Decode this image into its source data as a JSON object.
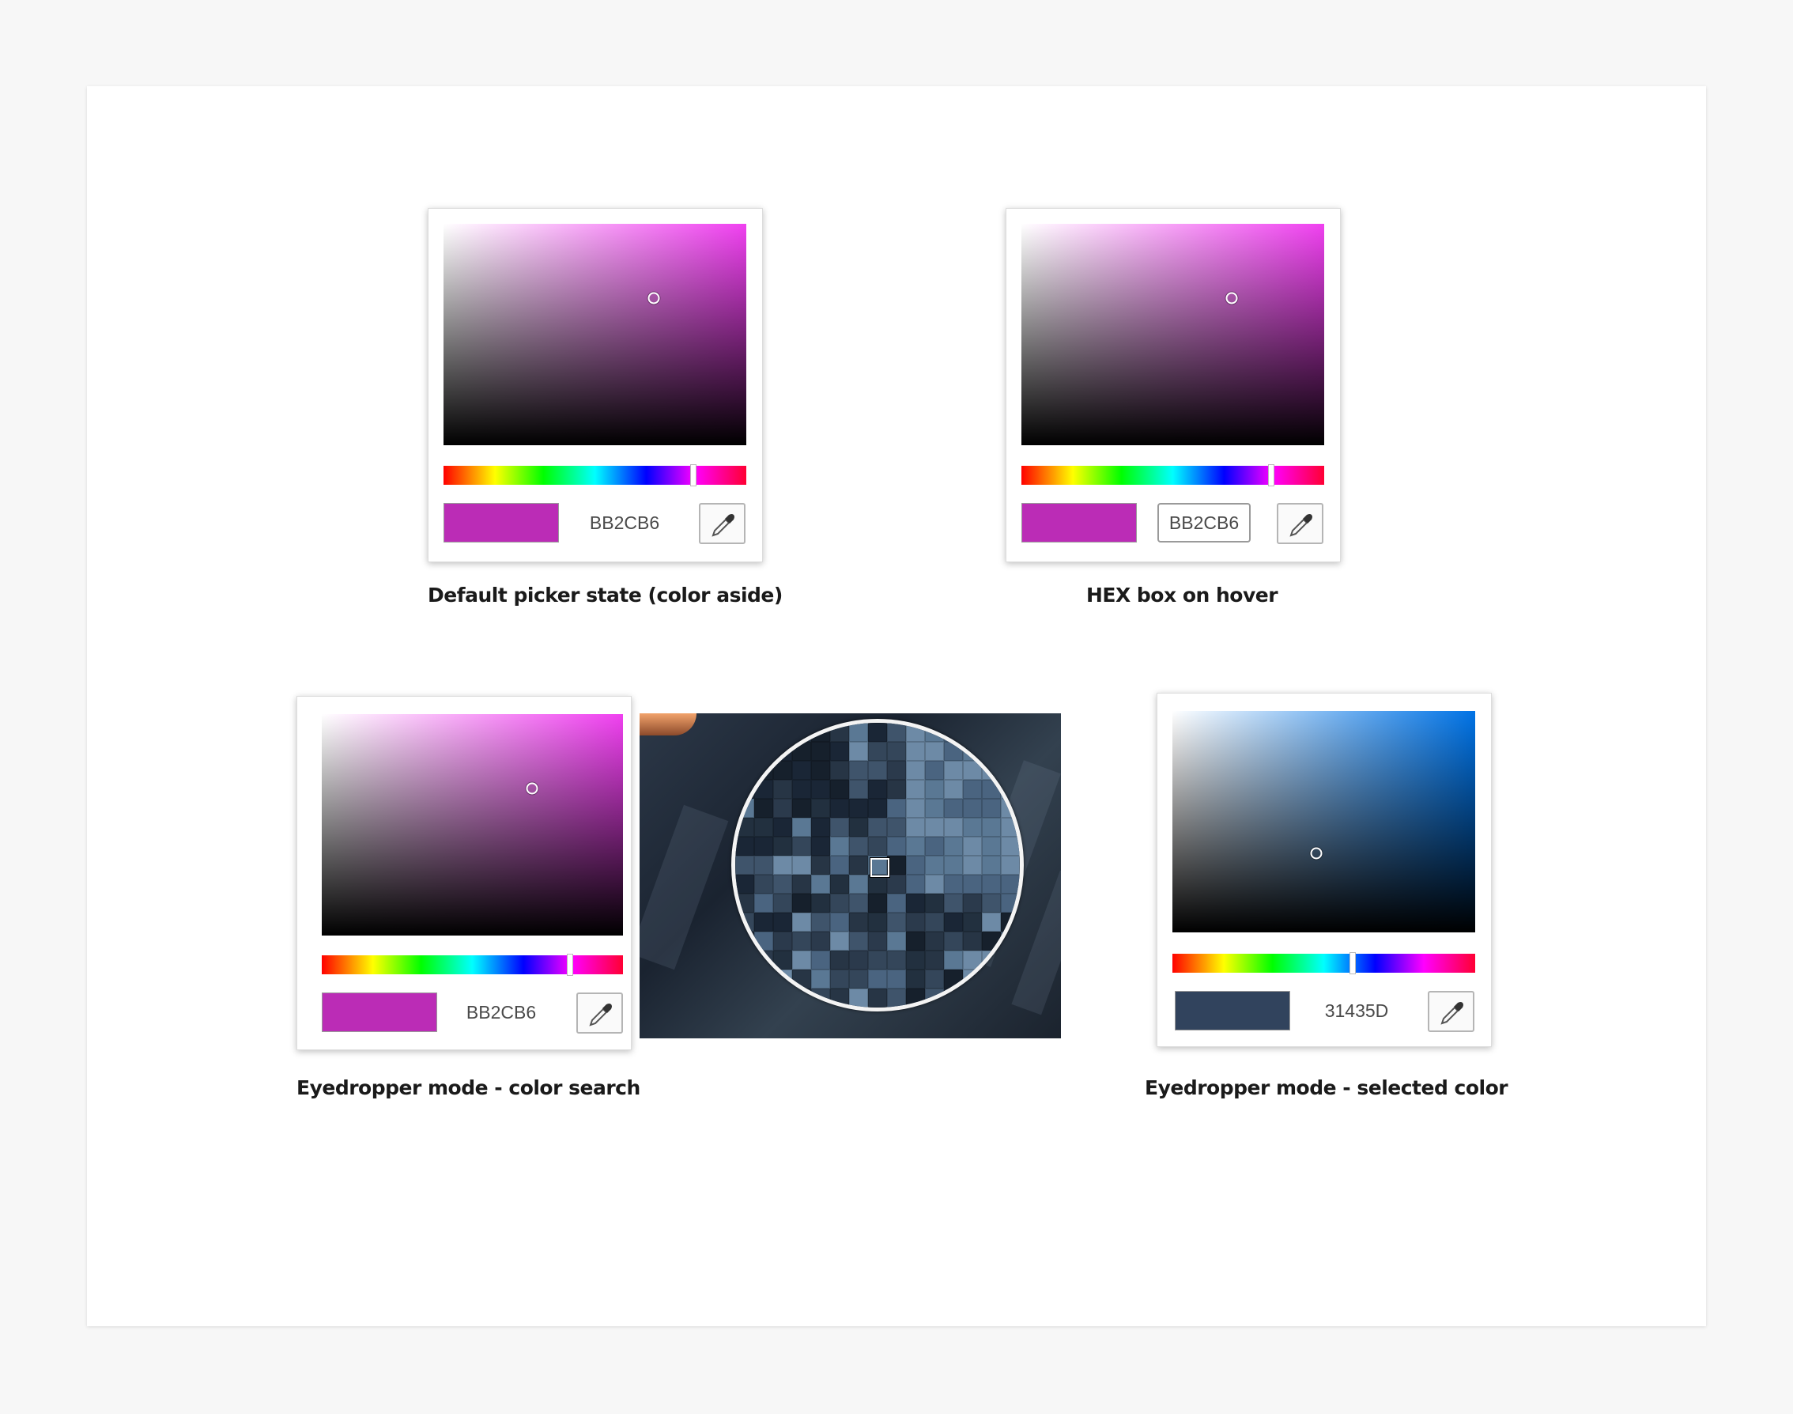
{
  "pickers": {
    "default": {
      "hex_value": "BB2CB6",
      "swatch_color": "#BB2CB6",
      "hue_color": "#f000f0",
      "caption": "Default picker state (color aside)"
    },
    "hover": {
      "hex_value": "BB2CB6",
      "swatch_color": "#BB2CB6",
      "hue_color": "#f000f0",
      "caption": "HEX box on hover"
    },
    "eyedropper_search": {
      "hex_value": "BB2CB6",
      "swatch_color": "#BB2CB6",
      "hue_color": "#f000f0",
      "caption": "Eyedropper mode - color search"
    },
    "eyedropper_selected": {
      "hex_value": "31435D",
      "swatch_color": "#31435D",
      "hue_color": "#0073e6",
      "caption": "Eyedropper mode - selected color"
    }
  },
  "icons": {
    "eyedropper": "eyedropper-icon"
  }
}
